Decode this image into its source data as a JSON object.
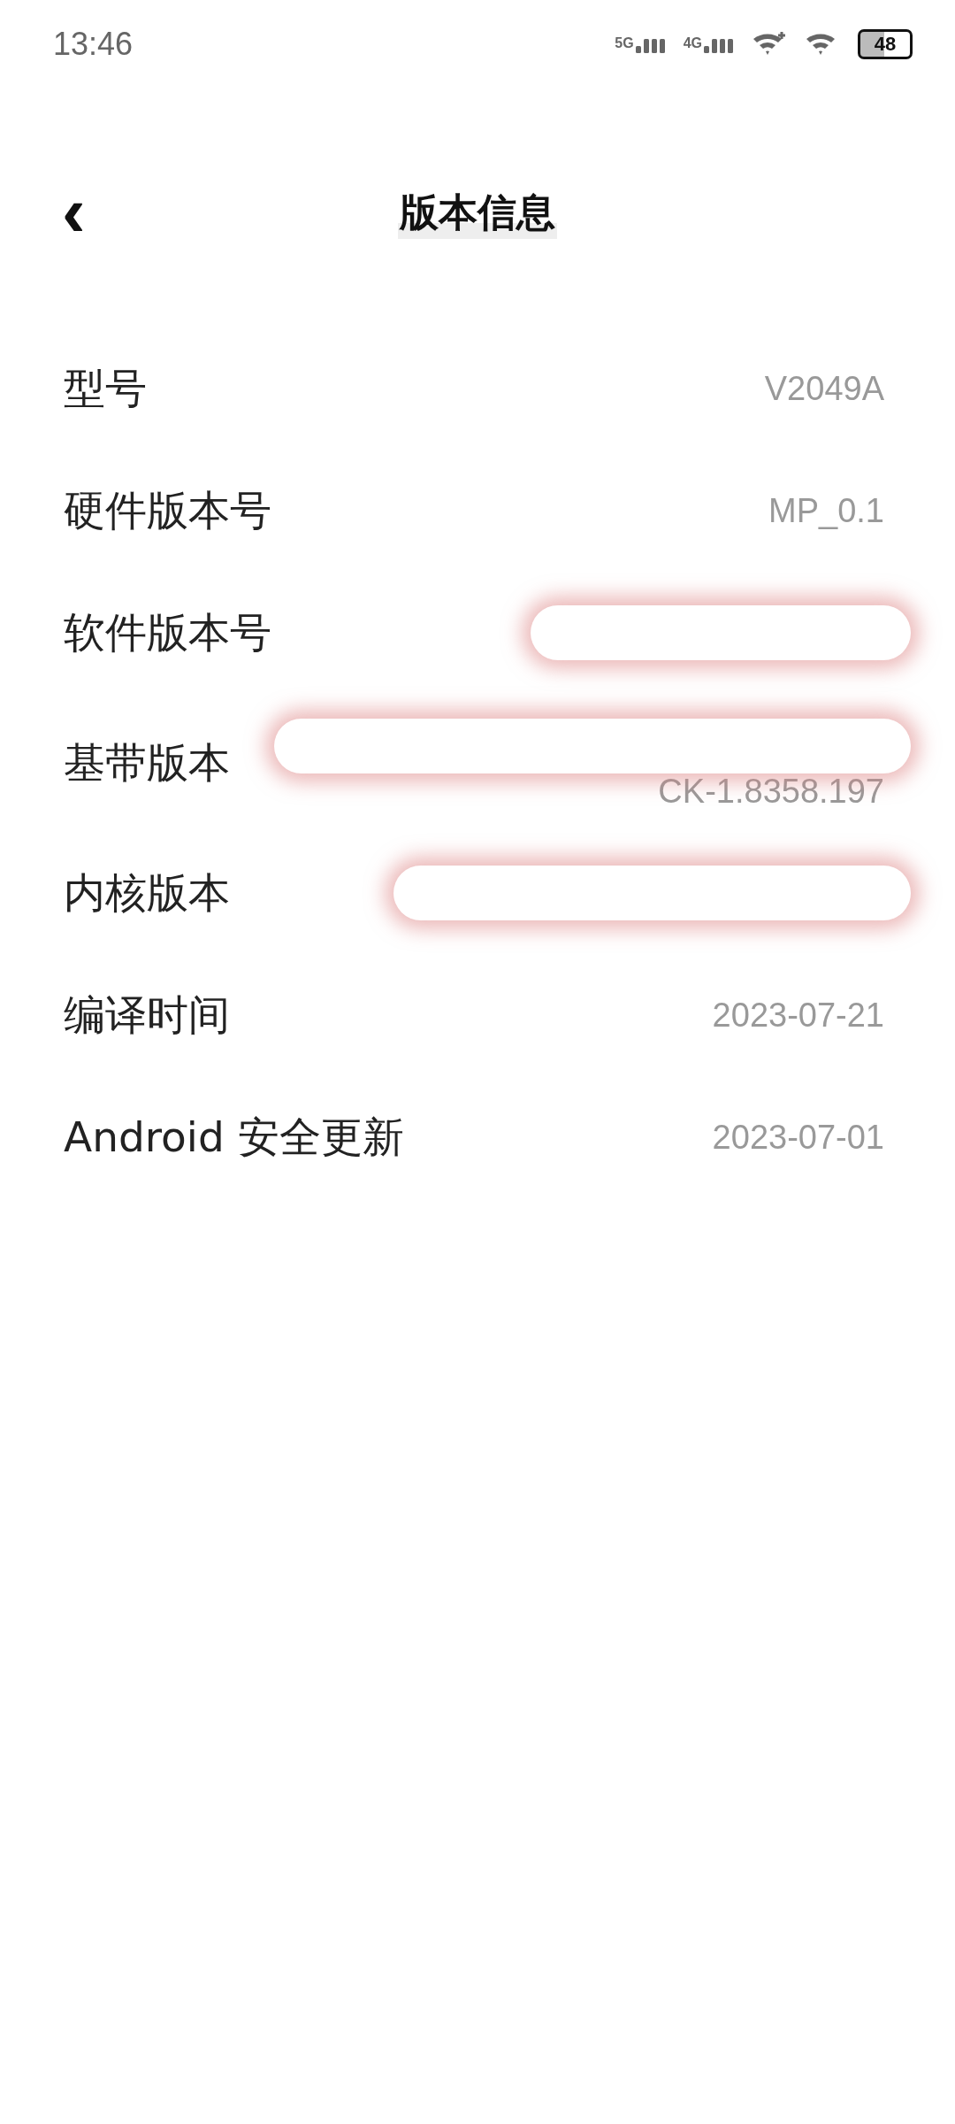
{
  "status_bar": {
    "time": "13:46",
    "battery": "48",
    "networks": [
      "5G",
      "4G"
    ]
  },
  "header": {
    "back": "‹",
    "title": "版本信息"
  },
  "rows": [
    {
      "label": "型号",
      "value": "V2049A",
      "redacted": false
    },
    {
      "label": "硬件版本号",
      "value": "MP_0.1",
      "redacted": false
    },
    {
      "label": "软件版本号",
      "redacted": true
    },
    {
      "label": "基带版本",
      "value": "CK-1.8358.197",
      "redacted": true
    },
    {
      "label": "内核版本",
      "redacted": true
    },
    {
      "label": "编译时间",
      "value": "2023-07-21",
      "redacted": false
    },
    {
      "label": "Android 安全更新",
      "value": "2023-07-01",
      "redacted": false
    }
  ]
}
